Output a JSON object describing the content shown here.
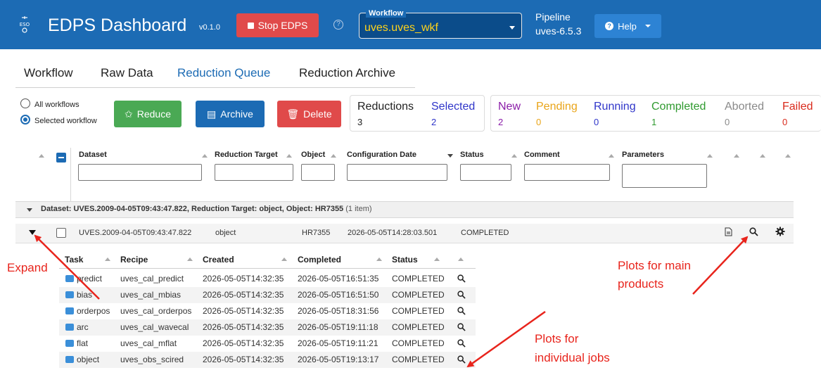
{
  "header": {
    "logo_text": "ESO",
    "title": "EDPS Dashboard",
    "version": "v0.1.0",
    "stop_button": "Stop EDPS",
    "workflow_label": "Workflow",
    "workflow_value": "uves.uves_wkf",
    "pipeline_label": "Pipeline",
    "pipeline_value": "uves-6.5.3",
    "help_button": "Help",
    "colors": {
      "bar": "#1c6bb4",
      "stop": "#e04a4a",
      "workflow_value": "#ffd21a"
    }
  },
  "tabs": [
    "Workflow",
    "Raw Data",
    "Reduction Queue",
    "Reduction Archive"
  ],
  "active_tab": "Reduction Queue",
  "filters": {
    "all_workflows": "All workflows",
    "selected_workflow": "Selected workflow",
    "selected": "Selected workflow"
  },
  "actions": {
    "reduce": "Reduce",
    "archive": "Archive",
    "delete": "Delete"
  },
  "counts": {
    "reductions": {
      "label": "Reductions",
      "value": "3"
    },
    "selected": {
      "label": "Selected",
      "value": "2"
    },
    "new": {
      "label": "New",
      "value": "2"
    },
    "pending": {
      "label": "Pending",
      "value": "0"
    },
    "running": {
      "label": "Running",
      "value": "0"
    },
    "completed": {
      "label": "Completed",
      "value": "1"
    },
    "aborted": {
      "label": "Aborted",
      "value": "0"
    },
    "failed": {
      "label": "Failed",
      "value": "0"
    }
  },
  "grid": {
    "columns": [
      "Dataset",
      "Reduction Target",
      "Object",
      "Configuration Date",
      "Status",
      "Comment",
      "Parameters"
    ],
    "group": {
      "label": "Dataset: UVES.2009-04-05T09:43:47.822, Reduction Target: object, Object: HR7355",
      "count": "(1 item)"
    },
    "row": {
      "dataset": "UVES.2009-04-05T09:43:47.822",
      "target": "object",
      "object": "HR7355",
      "config_date": "2026-05-05T14:28:03.501",
      "status": "COMPLETED"
    }
  },
  "jobs": {
    "columns": [
      "Task",
      "Recipe",
      "Created",
      "Completed",
      "Status"
    ],
    "rows": [
      {
        "task": "predict",
        "recipe": "uves_cal_predict",
        "created": "2026-05-05T14:32:35",
        "completed": "2026-05-05T16:51:35",
        "status": "COMPLETED"
      },
      {
        "task": "bias",
        "recipe": "uves_cal_mbias",
        "created": "2026-05-05T14:32:35",
        "completed": "2026-05-05T16:51:50",
        "status": "COMPLETED"
      },
      {
        "task": "orderpos",
        "recipe": "uves_cal_orderpos",
        "created": "2026-05-05T14:32:35",
        "completed": "2026-05-05T18:31:56",
        "status": "COMPLETED"
      },
      {
        "task": "arc",
        "recipe": "uves_cal_wavecal",
        "created": "2026-05-05T14:32:35",
        "completed": "2026-05-05T19:11:18",
        "status": "COMPLETED"
      },
      {
        "task": "flat",
        "recipe": "uves_cal_mflat",
        "created": "2026-05-05T14:32:35",
        "completed": "2026-05-05T19:11:21",
        "status": "COMPLETED"
      },
      {
        "task": "object",
        "recipe": "uves_obs_scired",
        "created": "2026-05-05T14:32:35",
        "completed": "2026-05-05T19:13:17",
        "status": "COMPLETED"
      }
    ]
  },
  "annotations": {
    "expand": "Expand",
    "main_plots_line1": "Plots for main",
    "main_plots_line2": "products",
    "job_plots_line1": "Plots for",
    "job_plots_line2": "individual jobs",
    "color": "#e8241c"
  }
}
